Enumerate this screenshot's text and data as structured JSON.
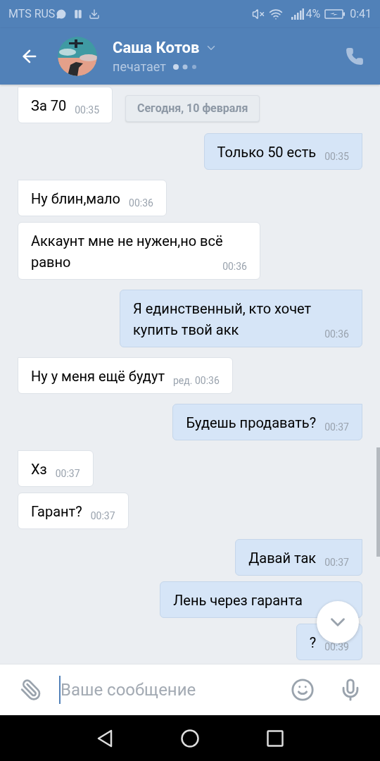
{
  "status_bar": {
    "carrier": "MTS RUS",
    "battery": "4%",
    "time": "0:41"
  },
  "header": {
    "name": "Саша Котов",
    "status": "печатает"
  },
  "date_separator": "Сегодня, 10 февраля",
  "messages": [
    {
      "kind": "incoming",
      "text": "За 70",
      "time": "00:35"
    },
    {
      "kind": "outgoing",
      "text": "Только 50 есть",
      "time": "00:35"
    },
    {
      "kind": "incoming",
      "text": "Ну блин,мало",
      "time": "00:36"
    },
    {
      "kind": "incoming",
      "text": "Аккаунт мне не нужен,но всё равно",
      "time": "00:36"
    },
    {
      "kind": "outgoing",
      "text": "Я единственный, кто хочет купить твой акк",
      "time": "00:36"
    },
    {
      "kind": "incoming",
      "text": "Ну у меня ещё будут",
      "time": "ред. 00:36"
    },
    {
      "kind": "outgoing",
      "text": "Будешь продавать?",
      "time": "00:37"
    },
    {
      "kind": "incoming",
      "text": "Хз",
      "time": "00:37"
    },
    {
      "kind": "incoming",
      "text": "Гарант?",
      "time": "00:37"
    },
    {
      "kind": "outgoing",
      "text": "Давай так",
      "time": "00:37"
    },
    {
      "kind": "outgoing",
      "text": "Лень через гаранта"
    },
    {
      "kind": "outgoing",
      "text": "?",
      "time": "00:39"
    }
  ],
  "composer": {
    "placeholder": "Ваше сообщение"
  }
}
